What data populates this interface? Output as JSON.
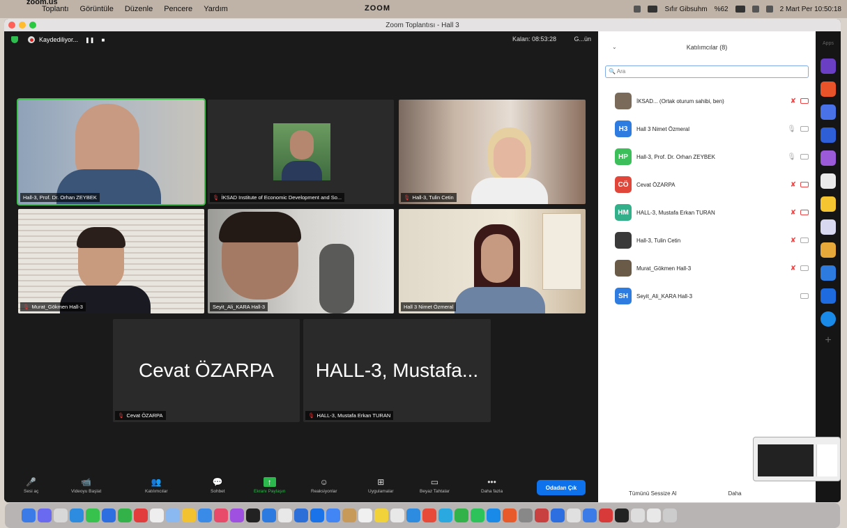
{
  "menubar": {
    "app": "zoom.us",
    "items": [
      "Toplantı",
      "Görüntüle",
      "Düzenle",
      "Pencere",
      "Yardım"
    ],
    "center": "ZOOM",
    "right_status": "Sıfır Gibsuhm",
    "percent": "%62",
    "datetime": "2 Mart Per 10:50:18"
  },
  "window": {
    "title": "Zoom Toplantısı - Hall 3"
  },
  "meeting": {
    "recording": "Kaydediliyor...",
    "timer": "Kalan: 08:53:28",
    "view": "G...ün",
    "tiles": [
      {
        "name": "Hall-3, Prof. Dr. Orhan ZEYBEK"
      },
      {
        "name": "İKSAD Institute of Economic Development and So..."
      },
      {
        "name": "Hall-3, Tulin Cetin"
      },
      {
        "name": "Murat_Gökmen Hall-3"
      },
      {
        "name": "Seyit_Ali_KARA Hall-3"
      },
      {
        "name": "Hall 3 Nimet Özmeral"
      },
      {
        "name": "Cevat ÖZARPA",
        "big": "Cevat ÖZARPA"
      },
      {
        "name": "HALL-3, Mustafa Erkan TURAN",
        "big": "HALL-3, Mustafa..."
      }
    ]
  },
  "toolbar": {
    "mute": "Sesi aç",
    "video": "Videoyu Başlat",
    "participants": "Katılımcılar",
    "chat": "Sohbet",
    "share": "Ekranı Paylaşın",
    "reactions": "Reaksiyonlar",
    "apps": "Uygulamalar",
    "whiteboard": "Beyaz Tahtalar",
    "more": "Daha fazla",
    "end": "Odadan Çık"
  },
  "panel": {
    "title": "Katılımcılar (8)",
    "search_placeholder": "Ara",
    "participants": [
      {
        "initials": "",
        "name": "İKSAD... (Ortak oturum sahibi, ben)",
        "color": "#7a6a5a"
      },
      {
        "initials": "H3",
        "name": "Hall 3 Nimet Özmeral",
        "color": "#2f7ce0"
      },
      {
        "initials": "HP",
        "name": "Hall-3, Prof. Dr. Orhan ZEYBEK",
        "color": "#3cbf5a"
      },
      {
        "initials": "CÖ",
        "name": "Cevat ÖZARPA",
        "color": "#e0473a"
      },
      {
        "initials": "HM",
        "name": "HALL-3, Mustafa Erkan TURAN",
        "color": "#33b08a"
      },
      {
        "initials": "",
        "name": "Hall-3, Tulin Cetin",
        "color": "#3a3a3a"
      },
      {
        "initials": "",
        "name": "Murat_Gökmen Hall-3",
        "color": "#6a5a48"
      },
      {
        "initials": "SH",
        "name": "Seyit_Ali_KARA Hall-3",
        "color": "#2f7ce0"
      }
    ],
    "mute_all": "Tümünü Sessize Al",
    "more": "Daha"
  },
  "apps_label": "Apps"
}
